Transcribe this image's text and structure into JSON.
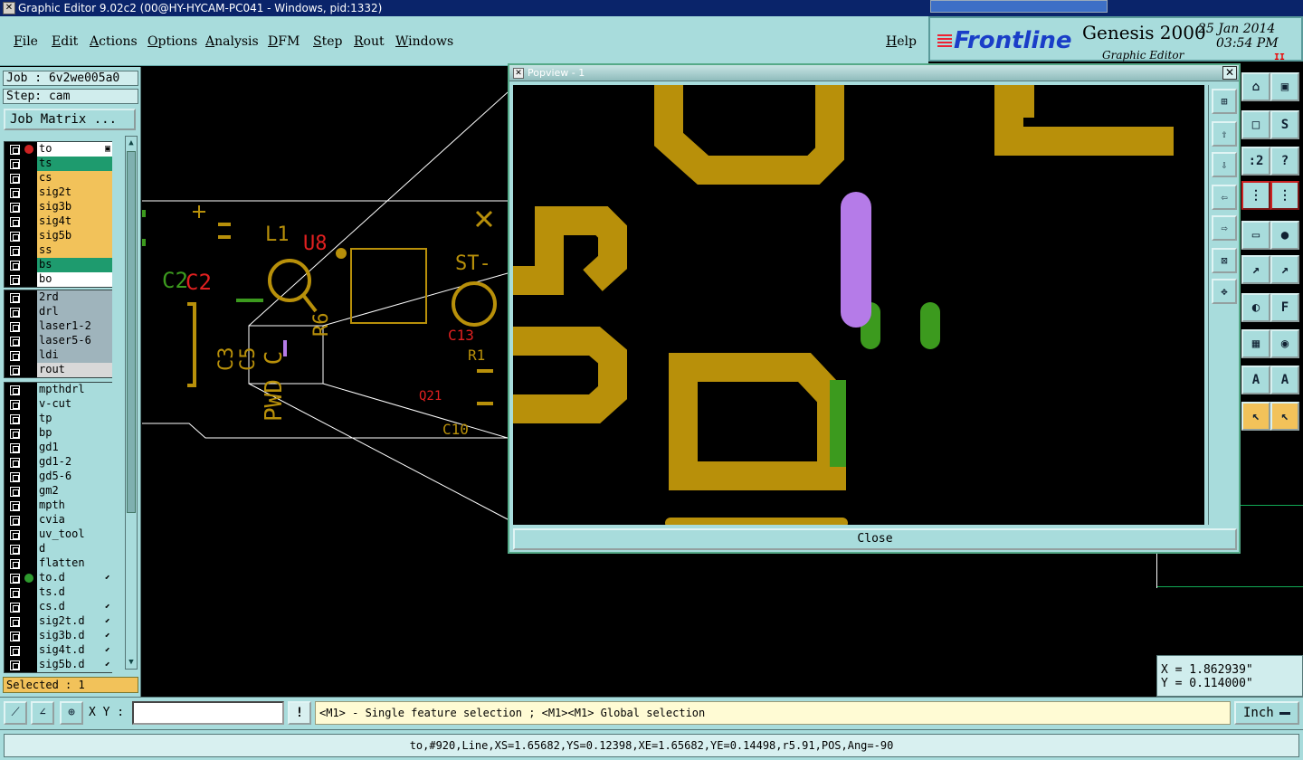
{
  "window": {
    "title": "Graphic Editor 9.02c2 (00@HY-HYCAM-PC041 - Windows, pid:1332)"
  },
  "menu": [
    "File",
    "Edit",
    "Actions",
    "Options",
    "Analysis",
    "DFM",
    "Step",
    "Rout",
    "Windows"
  ],
  "help_label": "Help",
  "brand": {
    "logo": "Frontline",
    "product": "Genesis 2000",
    "subtitle": "Graphic Editor",
    "date": "25 Jan 2014",
    "time": "03:54 PM",
    "pause": "II"
  },
  "job": {
    "job_line": "Job : 6v2we005a0",
    "step_line": "Step: cam",
    "matrix_button": "Job Matrix ..."
  },
  "layer_groups": [
    [
      {
        "name": "to",
        "color": "#ffffff",
        "mark": "#cc2222",
        "flag": "▣"
      },
      {
        "name": "ts",
        "color": "#1e9b6e",
        "mark": "",
        "flag": ""
      },
      {
        "name": "cs",
        "color": "#f2c25a",
        "mark": "",
        "flag": ""
      },
      {
        "name": "sig2t",
        "color": "#f2c25a",
        "mark": "",
        "flag": ""
      },
      {
        "name": "sig3b",
        "color": "#f2c25a",
        "mark": "",
        "flag": ""
      },
      {
        "name": "sig4t",
        "color": "#f2c25a",
        "mark": "",
        "flag": ""
      },
      {
        "name": "sig5b",
        "color": "#f2c25a",
        "mark": "",
        "flag": ""
      },
      {
        "name": "ss",
        "color": "#f2c25a",
        "mark": "",
        "flag": ""
      },
      {
        "name": "bs",
        "color": "#1e9b6e",
        "mark": "",
        "flag": ""
      },
      {
        "name": "bo",
        "color": "#ffffff",
        "mark": "",
        "flag": ""
      }
    ],
    [
      {
        "name": "2rd",
        "color": "#9fb4bc",
        "mark": "",
        "flag": ""
      },
      {
        "name": "drl",
        "color": "#9fb4bc",
        "mark": "",
        "flag": ""
      },
      {
        "name": "laser1-2",
        "color": "#9fb4bc",
        "mark": "",
        "flag": ""
      },
      {
        "name": "laser5-6",
        "color": "#9fb4bc",
        "mark": "",
        "flag": ""
      },
      {
        "name": "ldi",
        "color": "#9fb4bc",
        "mark": "",
        "flag": ""
      },
      {
        "name": "rout",
        "color": "#d8d8d8",
        "mark": "",
        "flag": ""
      }
    ],
    [
      {
        "name": "mpthdrl",
        "color": "#a8dcdc",
        "mark": "",
        "flag": ""
      },
      {
        "name": "v-cut",
        "color": "#a8dcdc",
        "mark": "",
        "flag": ""
      },
      {
        "name": "tp",
        "color": "#a8dcdc",
        "mark": "",
        "flag": ""
      },
      {
        "name": "bp",
        "color": "#a8dcdc",
        "mark": "",
        "flag": ""
      },
      {
        "name": "gd1",
        "color": "#a8dcdc",
        "mark": "",
        "flag": ""
      },
      {
        "name": "gd1-2",
        "color": "#a8dcdc",
        "mark": "",
        "flag": ""
      },
      {
        "name": "gd5-6",
        "color": "#a8dcdc",
        "mark": "",
        "flag": ""
      },
      {
        "name": "gm2",
        "color": "#a8dcdc",
        "mark": "",
        "flag": ""
      },
      {
        "name": "mpth",
        "color": "#a8dcdc",
        "mark": "",
        "flag": ""
      },
      {
        "name": "cvia",
        "color": "#a8dcdc",
        "mark": "",
        "flag": ""
      },
      {
        "name": "uv_tool",
        "color": "#a8dcdc",
        "mark": "",
        "flag": ""
      },
      {
        "name": "d",
        "color": "#a8dcdc",
        "mark": "",
        "flag": ""
      },
      {
        "name": "flatten",
        "color": "#a8dcdc",
        "mark": "",
        "flag": ""
      },
      {
        "name": "to.d",
        "color": "#a8dcdc",
        "mark": "#2e9a2e",
        "flag": "⬋"
      },
      {
        "name": "ts.d",
        "color": "#a8dcdc",
        "mark": "",
        "flag": ""
      },
      {
        "name": "cs.d",
        "color": "#a8dcdc",
        "mark": "",
        "flag": "⬋"
      },
      {
        "name": "sig2t.d",
        "color": "#a8dcdc",
        "mark": "",
        "flag": "⬋"
      },
      {
        "name": "sig3b.d",
        "color": "#a8dcdc",
        "mark": "",
        "flag": "⬋"
      },
      {
        "name": "sig4t.d",
        "color": "#a8dcdc",
        "mark": "",
        "flag": "⬋"
      },
      {
        "name": "sig5b.d",
        "color": "#a8dcdc",
        "mark": "",
        "flag": "⬋"
      }
    ]
  ],
  "selected": "Selected : 1",
  "canvas_labels": {
    "l1": "L1",
    "u8": "U8",
    "c2_a": "C2",
    "c2_b": "C2",
    "st": "ST-",
    "c13": "C13",
    "r1": "R1",
    "r6": "R6",
    "c3": "C3",
    "c5": "C5",
    "pwd": "PWD C",
    "q21": "Q21",
    "c10": "C10"
  },
  "popview": {
    "title": "Popview - 1",
    "close_label": "Close"
  },
  "coords": {
    "x": "X = 1.862939\"",
    "y": "Y = 0.114000\""
  },
  "bottom": {
    "xy_label": "X Y :",
    "xy_value": "",
    "bang": "!",
    "hint": "<M1> - Single feature selection ; <M1><M1> Global selection",
    "units": "Inch"
  },
  "status": "to,#920,Line,XS=1.65682,YS=0.12398,XE=1.65682,YE=0.14498,r5.91,POS,Ang=-90",
  "colors": {
    "panel": "#a8dcdc",
    "copper": "#b8900a",
    "mask": "#3c9a1e",
    "highlight": "#b57be8",
    "title": "#0a246a"
  }
}
